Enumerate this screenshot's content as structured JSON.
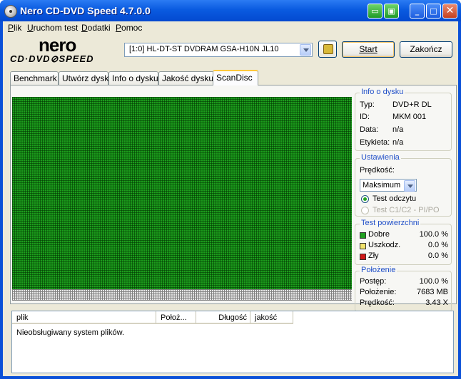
{
  "window": {
    "title": "Nero CD-DVD Speed 4.7.0.0",
    "title_controls": [
      "▭",
      "▣",
      "_",
      "□",
      "✕"
    ]
  },
  "menu": {
    "items": [
      "Plik",
      "Uruchom test",
      "Dodatki",
      "Pomoc"
    ]
  },
  "logo": {
    "top": "nero",
    "bottom": "CD·DVD⊘SPEED"
  },
  "toolbar": {
    "drive": "[1:0]   HL-DT-ST DVDRAM GSA-H10N JL10",
    "start_label": "Start",
    "end_label": "Zakończ"
  },
  "tabs": [
    "Benchmark",
    "Utwórz dysk",
    "Info o dysku",
    "Jakość dysku",
    "ScanDisc"
  ],
  "active_tab": "ScanDisc",
  "disc_info": {
    "title": "Info o dysku",
    "rows": [
      {
        "label": "Typ:",
        "value": "DVD+R DL"
      },
      {
        "label": "ID:",
        "value": "MKM 001"
      },
      {
        "label": "Data:",
        "value": "n/a"
      },
      {
        "label": "Etykieta:",
        "value": "n/a"
      }
    ]
  },
  "settings": {
    "title": "Ustawienia",
    "speed_label": "Prędkość:",
    "speed_value": "Maksimum",
    "radio_read": "Test odczytu",
    "radio_c1c2": "Test C1/C2 - PI/PO"
  },
  "surface": {
    "title": "Test powierzchni",
    "rows": [
      {
        "label": "Dobre",
        "value": "100.0 %",
        "color": "#21a121"
      },
      {
        "label": "Uszkodz.",
        "value": "0.0 %",
        "color": "#f2e36a"
      },
      {
        "label": "Zły",
        "value": "0.0 %",
        "color": "#d01818"
      }
    ]
  },
  "position": {
    "title": "Położenie",
    "rows": [
      {
        "label": "Postęp:",
        "value": "100.0 %"
      },
      {
        "label": "Położenie:",
        "value": "7683 MB"
      },
      {
        "label": "Prędkość:",
        "value": "3.43 X"
      }
    ]
  },
  "filelist": {
    "columns": [
      "plik",
      "Położ...",
      "Długość",
      "jakość"
    ],
    "message": "Nieobsługiwany system plików."
  }
}
